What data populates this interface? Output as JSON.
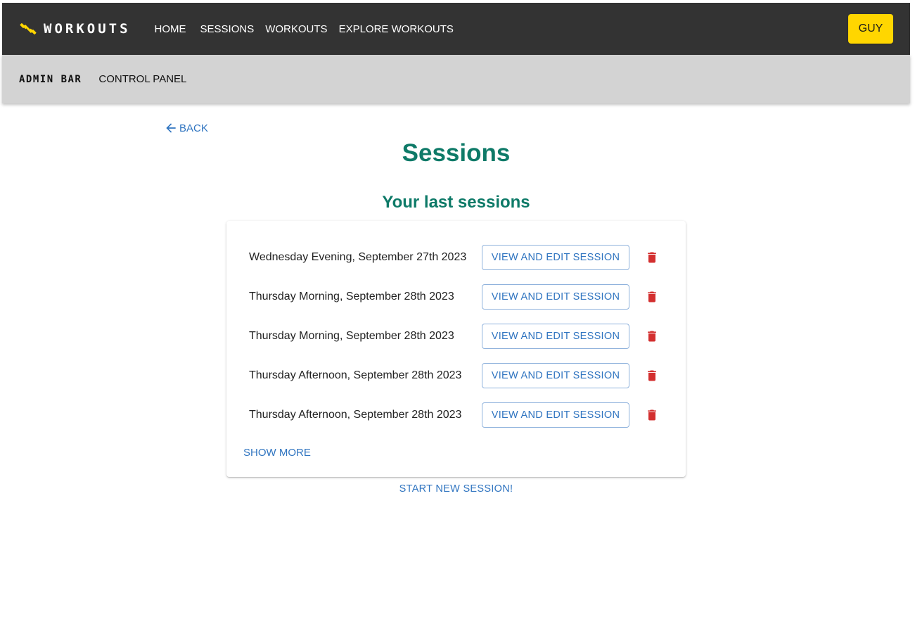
{
  "navbar": {
    "brand": "WORKOUTS",
    "brand_icon": "dumbbell-icon",
    "links": [
      {
        "label": "HOME"
      },
      {
        "label": "SESSIONS"
      },
      {
        "label": "WORKOUTS"
      },
      {
        "label": "EXPLORE WORKOUTS"
      }
    ],
    "user_button": "GUY"
  },
  "admin_bar": {
    "title": "ADMIN BAR",
    "link": "CONTROL PANEL"
  },
  "back_label": "BACK",
  "page_title": "Sessions",
  "section_title": "Your last sessions",
  "sessions": [
    {
      "label": "Wednesday Evening, September 27th 2023",
      "button": "VIEW AND EDIT SESSION"
    },
    {
      "label": "Thursday Morning, September 28th 2023",
      "button": "VIEW AND EDIT SESSION"
    },
    {
      "label": "Thursday Morning, September 28th 2023",
      "button": "VIEW AND EDIT SESSION"
    },
    {
      "label": "Thursday Afternoon, September 28th 2023",
      "button": "VIEW AND EDIT SESSION"
    },
    {
      "label": "Thursday Afternoon, September 28th 2023",
      "button": "VIEW AND EDIT SESSION"
    }
  ],
  "show_more_label": "SHOW MORE",
  "start_new_label": "START NEW SESSION!",
  "colors": {
    "navbar_bg": "#333333",
    "admin_bar_bg": "#d3d3d3",
    "accent_yellow": "#ffd600",
    "heading_green": "#0e7a68",
    "link_blue": "#2f74c0",
    "delete_red": "#d32f2f"
  }
}
